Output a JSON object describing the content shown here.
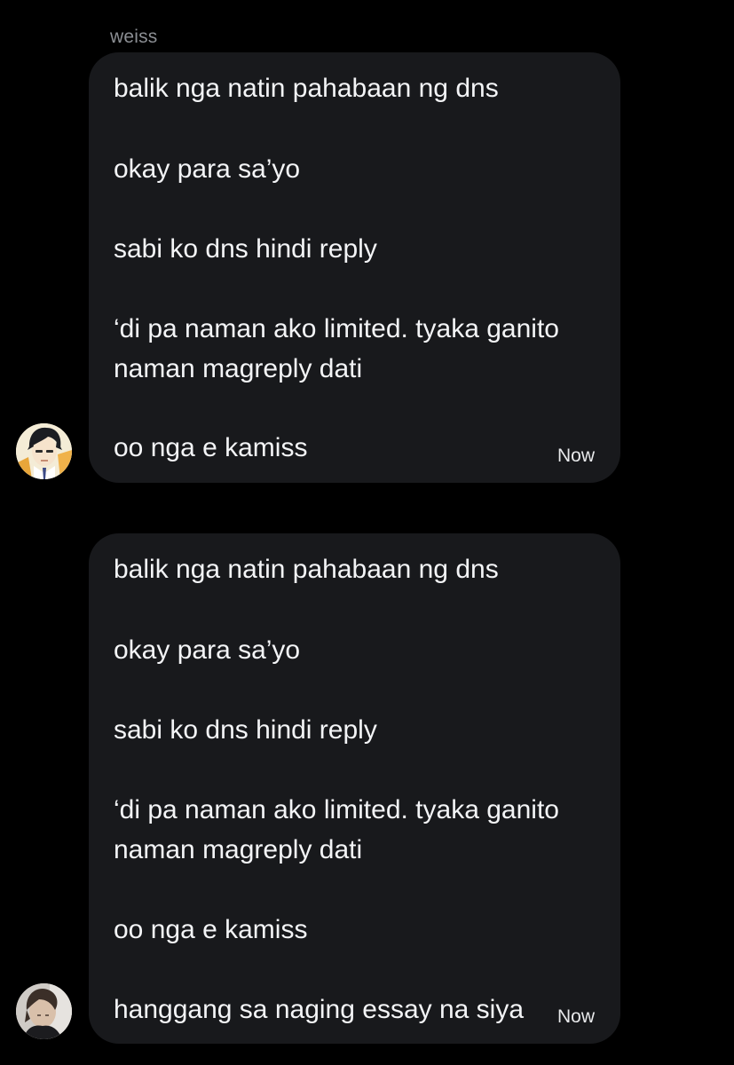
{
  "thread": {
    "sender_name": "weiss",
    "messages": [
      {
        "lines": [
          "balik nga natin pahabaan ng dns",
          "okay para sa’yo",
          "sabi ko dns hindi reply",
          "‘di pa naman ako limited. tyaka ganito",
          "naman magreply dati",
          "oo nga e kamiss"
        ],
        "timestamp": "Now",
        "avatar_icon": "anime-character-avatar"
      },
      {
        "lines": [
          "balik nga natin pahabaan ng dns",
          "okay para sa’yo",
          "sabi ko dns hindi reply",
          "‘di pa naman ako limited. tyaka ganito",
          "naman magreply dati",
          "oo nga e kamiss",
          "hanggang sa naging essay na siya"
        ],
        "timestamp": "Now",
        "avatar_icon": "profile-photo-avatar"
      }
    ]
  },
  "colors": {
    "background": "#000000",
    "bubble": "#18191c",
    "text": "#f3f4f6",
    "sender_name": "#8b8e93"
  }
}
